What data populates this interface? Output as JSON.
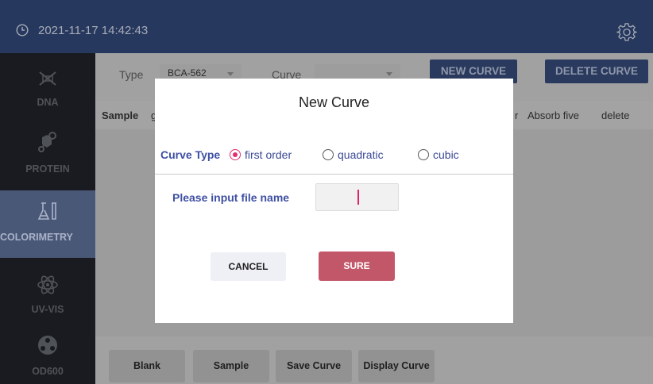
{
  "header": {
    "datetime": "2021-11-17 14:42:43",
    "clock_icon": "clock-icon",
    "settings_icon": "gear-icon"
  },
  "sidebar": {
    "items": [
      {
        "label": "DNA",
        "icon": "dna-icon",
        "active": false
      },
      {
        "label": "PROTEIN",
        "icon": "protein-molecule-icon",
        "active": false
      },
      {
        "label": "COLORIMETRY",
        "icon": "lab-flask-icon",
        "active": true
      },
      {
        "label": "UV-VIS",
        "icon": "atom-icon",
        "active": false
      },
      {
        "label": "OD600",
        "icon": "cell-icon",
        "active": false
      }
    ]
  },
  "toolbar": {
    "type_label": "Type",
    "type_value": "BCA-562",
    "curve_label": "Curve",
    "curve_value": "",
    "new_curve_label": "NEW CURVE",
    "delete_curve_label": "DELETE CURVE"
  },
  "table": {
    "headers": [
      "Sample",
      "g",
      "r",
      "Absorb five",
      "delete"
    ]
  },
  "bottom_buttons": [
    "Blank",
    "Sample",
    "Save Curve",
    "Display Curve"
  ],
  "modal": {
    "title": "New Curve",
    "curve_type_label": "Curve Type",
    "options": [
      {
        "label": "first order",
        "selected": true
      },
      {
        "label": "quadratic",
        "selected": false
      },
      {
        "label": "cubic",
        "selected": false
      }
    ],
    "file_name_label": "Please input file name",
    "file_name_value": "",
    "cancel_label": "CANCEL",
    "sure_label": "SURE"
  },
  "colors": {
    "topbar": "#27385f",
    "sidebar": "#1a1b20",
    "accent_pink": "#e02e6e",
    "sure_button": "#c25769",
    "label_blue": "#3e4fa3"
  }
}
